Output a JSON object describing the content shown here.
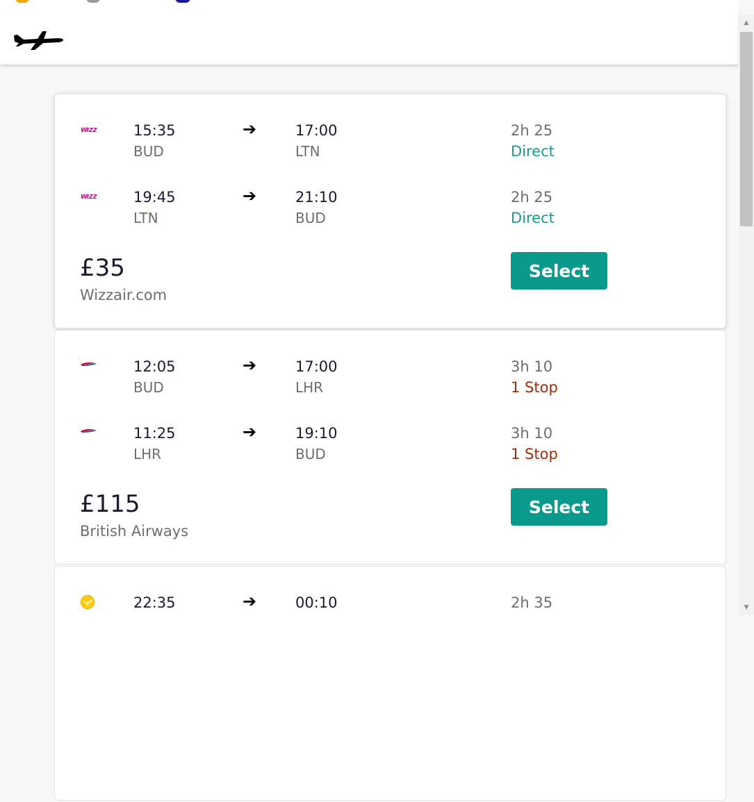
{
  "icons": {
    "logo": "airplane-icon",
    "arrow": "arrow-right-icon",
    "scroll_up": "triangle-up-icon",
    "scroll_down": "triangle-down-icon"
  },
  "colors": {
    "accent": "#0a9a8c",
    "direct": "#1a9a8a",
    "stop": "#a32a0a",
    "price_text": "#1a1a2e",
    "muted": "#6d6d6d"
  },
  "results": [
    {
      "airline_logo": "wizzair-logo-icon",
      "price": "£35",
      "vendor": "Wizzair.com",
      "select_label": "Select",
      "legs": [
        {
          "depart_time": "15:35",
          "depart_code": "BUD",
          "arrive_time": "17:00",
          "arrive_code": "LTN",
          "duration": "2h 25",
          "stops": "Direct",
          "stop_type": "direct"
        },
        {
          "depart_time": "19:45",
          "depart_code": "LTN",
          "arrive_time": "21:10",
          "arrive_code": "BUD",
          "duration": "2h 25",
          "stops": "Direct",
          "stop_type": "direct"
        }
      ]
    },
    {
      "airline_logo": "british-airways-logo-icon",
      "price": "£115",
      "vendor": "British Airways",
      "select_label": "Select",
      "legs": [
        {
          "depart_time": "12:05",
          "depart_code": "BUD",
          "arrive_time": "17:00",
          "arrive_code": "LHR",
          "duration": "3h 10",
          "stops": "1 Stop",
          "stop_type": "stop"
        },
        {
          "depart_time": "11:25",
          "depart_code": "LHR",
          "arrive_time": "19:10",
          "arrive_code": "BUD",
          "duration": "3h 10",
          "stops": "1 Stop",
          "stop_type": "stop"
        }
      ]
    },
    {
      "airline_logo": "lufthansa-logo-icon",
      "legs": [
        {
          "depart_time": "22:35",
          "arrive_time": "00:10",
          "duration": "2h 35"
        }
      ]
    }
  ]
}
